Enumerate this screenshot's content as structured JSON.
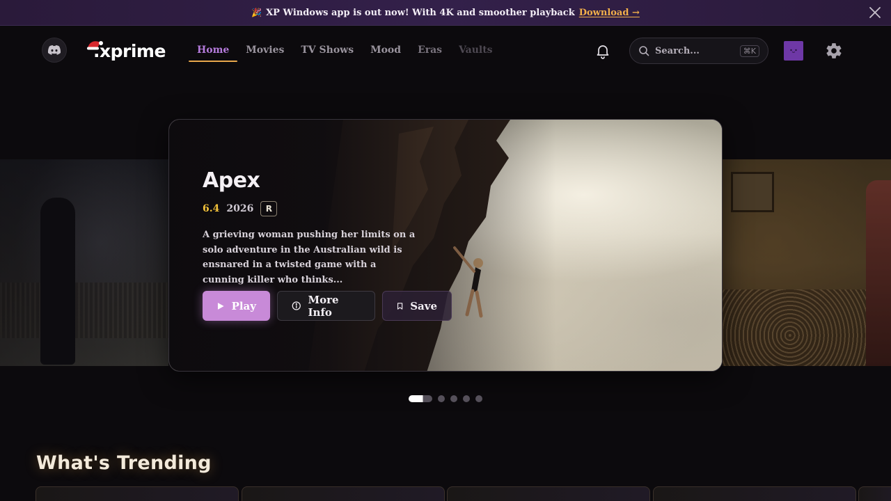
{
  "announcement": {
    "emoji": "🎉",
    "message": "XP Windows app is out now! With 4K and smoother playback",
    "cta": "Download →"
  },
  "nav": {
    "logo": ".xprime",
    "links": [
      "Home",
      "Movies",
      "TV Shows",
      "Mood",
      "Eras",
      "Vaults"
    ],
    "active": "Home",
    "search": {
      "placeholder": "Search...",
      "shortcut": "⌘K"
    }
  },
  "hero": {
    "title": "Apex",
    "rating": "6.4",
    "year": "2026",
    "certification": "R",
    "description": "A grieving woman pushing her limits on a solo adventure in the Australian wild is ensnared in a twisted game with a cunning killer who thinks...",
    "buttons": {
      "play": "Play",
      "more_info": "More Info",
      "save": "Save"
    },
    "slide_count": 5,
    "active_slide": 1
  },
  "trending": {
    "title": "What's Trending",
    "card_count": 5
  },
  "colors": {
    "accent_purple": "#b57bdc",
    "accent_orange": "#e9a84c",
    "rating_yellow": "#f2c23a",
    "play_button": "#c88ad8",
    "avatar": "#6e38a6"
  }
}
